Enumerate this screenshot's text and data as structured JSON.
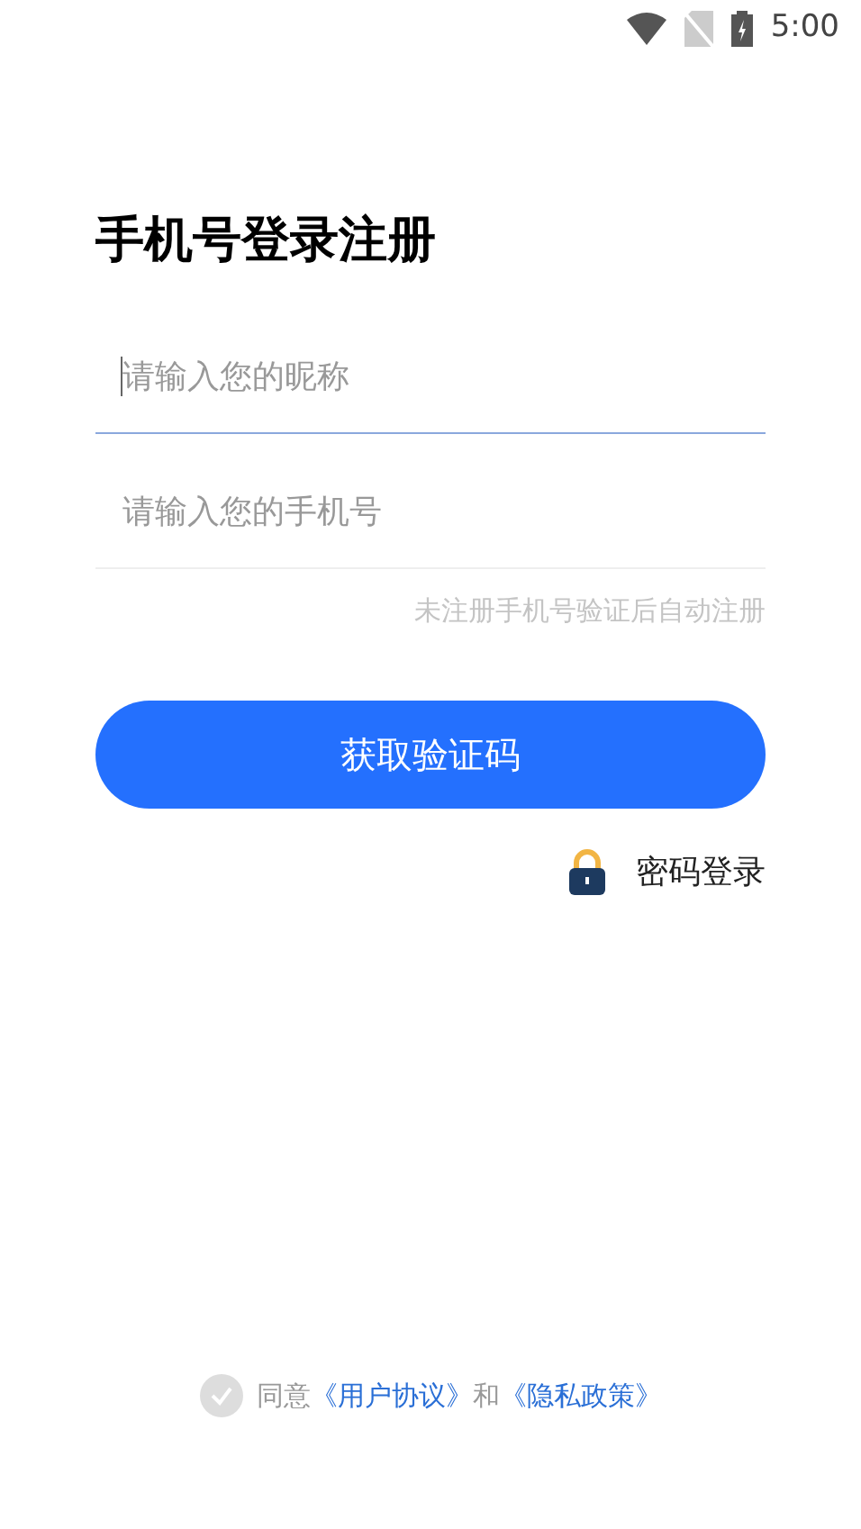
{
  "status_bar": {
    "time": "5:00"
  },
  "title": "手机号登录注册",
  "fields": [
    {
      "placeholder": "请输入您的昵称",
      "focused": true
    },
    {
      "placeholder": "请输入您的手机号",
      "focused": false
    }
  ],
  "hint": "未注册手机号验证后自动注册",
  "submit_button": "获取验证码",
  "password_login": "密码登录",
  "agreement": {
    "checked": false,
    "parts": [
      {
        "kind": "text",
        "text": "同意"
      },
      {
        "kind": "link",
        "text": "《用户协议》"
      },
      {
        "kind": "text",
        "text": "和"
      },
      {
        "kind": "link",
        "text": "《隐私政策》"
      }
    ]
  }
}
